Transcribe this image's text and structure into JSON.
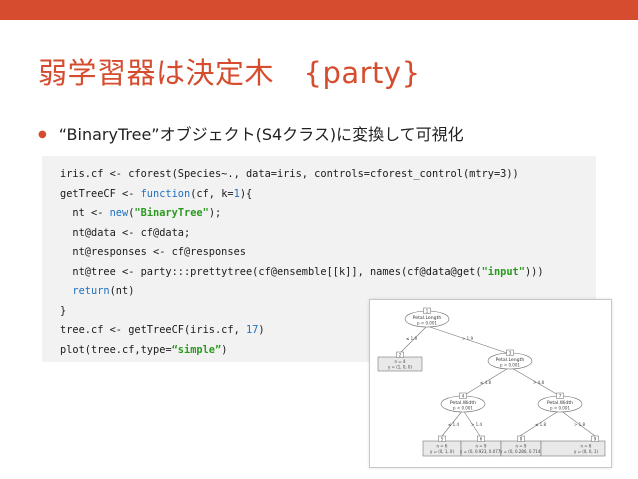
{
  "slide": {
    "title": "弱学習器は決定木　{party}",
    "bullet": "“BinaryTree”オブジェクト(S4クラス)に変換して可視化"
  },
  "code": {
    "line1": "iris.cf <- cforest(Species~., data=iris, controls=cforest_control(mtry=3))",
    "l2_a": "getTreeCF <- ",
    "l2_kw": "function",
    "l2_b": "(cf, k=",
    "l2_num": "1",
    "l2_c": "){",
    "l3_a": "  nt <- ",
    "l3_kw": "new",
    "l3_b": "(",
    "l3_str": "\"BinaryTree\"",
    "l3_c": ");",
    "line4": "  nt@data <- cf@data;",
    "line5": "  nt@responses <- cf@responses",
    "l6_a": "  nt@tree <- party:::prettytree(cf@ensemble[[k]], names(cf@data@get(",
    "l6_str": "\"input\"",
    "l6_b": ")))",
    "l7_indent": "  ",
    "l7_kw": "return",
    "l7_b": "(nt)",
    "line8": "}",
    "l9_a": "tree.cf <- getTreeCF(iris.cf, ",
    "l9_num": "17",
    "l9_b": ")",
    "l10_a": "plot(tree.cf,type=",
    "l10_str": "“simple”",
    "l10_b": ")"
  },
  "tree": {
    "node1": {
      "id": "1",
      "var": "Petal.Length",
      "p": "p < 0.001"
    },
    "edge1_left": "≤ 1.9",
    "edge1_right": "> 1.9",
    "node2": {
      "id": "2",
      "n": "n = 4",
      "y": "y = (1, 0, 0)"
    },
    "node3": {
      "id": "3",
      "var": "Petal.Length",
      "p": "p < 0.001"
    },
    "edge3_left": "≤ 4.8",
    "edge3_right": "> 4.8",
    "node4": {
      "id": "4",
      "var": "Petal.Width",
      "p": "p < 0.001"
    },
    "edge4_left": "≤ 1.4",
    "edge4_right": "> 1.4",
    "node7": {
      "id": "7",
      "var": "Petal.Width",
      "p": "p < 0.001"
    },
    "edge7_left": "≤ 1.8",
    "edge7_right": "> 1.8",
    "node5": {
      "id": "5",
      "n": "n = 6",
      "y": "y = (0, 1, 0)"
    },
    "node6": {
      "id": "6",
      "n": "n = 9",
      "y": "y = (0, 0.923, 0.077)"
    },
    "node8": {
      "id": "8",
      "n": "n = 9",
      "y": "y = (0, 0.286, 0.714)"
    },
    "node9": {
      "id": "9",
      "n": "n = 6",
      "y": "y = (0, 0, 1)"
    }
  }
}
